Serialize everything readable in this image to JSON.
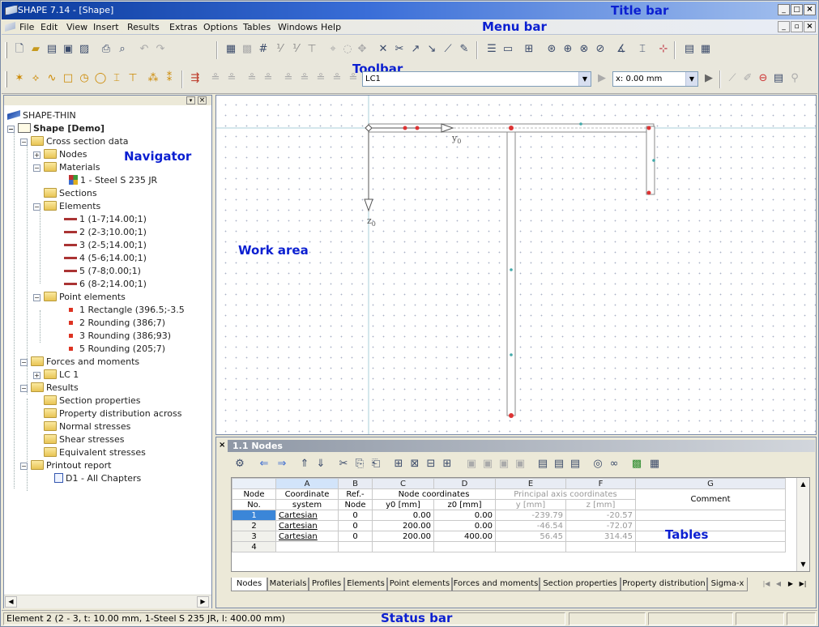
{
  "window": {
    "title": "SHAPE 7.14 - [Shape]"
  },
  "annotations": {
    "title_bar": "Title bar",
    "menu_bar": "Menu bar",
    "toolbar": "Toolbar",
    "navigator": "Navigator",
    "work_area": "Work area",
    "tables": "Tables",
    "status_bar": "Status bar"
  },
  "menu": [
    "File",
    "Edit",
    "View",
    "Insert",
    "Results",
    "Extras",
    "Options",
    "Tables",
    "Windows",
    "Help"
  ],
  "toolbar": {
    "load_case": "LC1",
    "coord_value": "x: 0.00 mm"
  },
  "navigator": {
    "root": "SHAPE-THIN",
    "model": "Shape [Demo]",
    "items": [
      "Cross section data",
      "Nodes",
      "Materials",
      "1 - Steel S 235 JR",
      "Sections",
      "Elements",
      "1 (1-7;14.00;1)",
      "2 (2-3;10.00;1)",
      "3 (2-5;14.00;1)",
      "4 (5-6;14.00;1)",
      "5 (7-8;0.00;1)",
      "6 (8-2;14.00;1)",
      "Point elements",
      "1 Rectangle (396.5;-3.5",
      "2 Rounding (386;7)",
      "3 Rounding (386;93)",
      "5 Rounding (205;7)",
      "Forces and moments",
      "LC 1",
      "Results",
      "Section properties",
      "Property distribution across",
      "Normal stresses",
      "Shear stresses",
      "Equivalent stresses",
      "Printout report",
      "D1 - All Chapters"
    ]
  },
  "work_area": {
    "axis_y": "y",
    "axis_z": "z",
    "axis_sub": "0"
  },
  "tables": {
    "title": "1.1 Nodes",
    "columns": [
      "A",
      "B",
      "C",
      "D",
      "E",
      "F",
      "G"
    ],
    "header1": {
      "no": "Node",
      "sys": "Coordinate",
      "ref": "Ref.-",
      "nc": "Node coordinates",
      "pa": "Principal axis coordinates",
      "comment": "Comment"
    },
    "header2": {
      "no": "No.",
      "sys": "system",
      "ref": "Node",
      "y0": "y0 [mm]",
      "z0": "z0 [mm]",
      "y": "y [mm]",
      "z": "z [mm]"
    },
    "rows": [
      {
        "no": "1",
        "sys": "Cartesian",
        "ref": "0",
        "y0": "0.00",
        "z0": "0.00",
        "y": "-239.79",
        "z": "-20.57"
      },
      {
        "no": "2",
        "sys": "Cartesian",
        "ref": "0",
        "y0": "200.00",
        "z0": "0.00",
        "y": "-46.54",
        "z": "-72.07"
      },
      {
        "no": "3",
        "sys": "Cartesian",
        "ref": "0",
        "y0": "200.00",
        "z0": "400.00",
        "y": "56.45",
        "z": "314.45"
      },
      {
        "no": "4",
        "sys": "",
        "ref": "",
        "y0": "",
        "z0": "",
        "y": "",
        "z": ""
      }
    ],
    "tabs": [
      "Nodes",
      "Materials",
      "Profiles",
      "Elements",
      "Point elements",
      "Forces and moments",
      "Section properties",
      "Property distribution",
      "Sigma-x"
    ]
  },
  "status": {
    "text": "Element 2 (2 - 3, t: 10.00 mm, 1-Steel S 235 JR, l: 400.00 mm)"
  }
}
